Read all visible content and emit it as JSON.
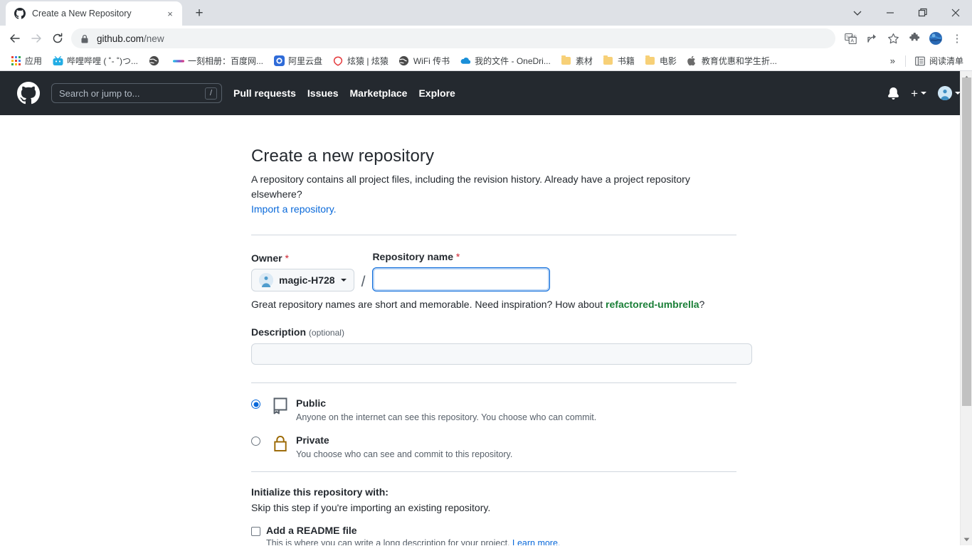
{
  "browser": {
    "tab": {
      "title": "Create a New Repository",
      "favicon": "github-icon",
      "close": "×"
    },
    "new_tab_label": "+",
    "window_controls": {
      "minimize": "—",
      "maximize": "❐",
      "close": "×",
      "tab_search": "⌄"
    },
    "toolbar": {
      "back": "←",
      "forward": "→",
      "reload": "⟳",
      "lock": "lock-icon",
      "url_secure": "github.com",
      "url_path": "/new",
      "translate": "translate-icon",
      "share": "share-icon",
      "bookmark": "star-icon",
      "extensions": "puzzle-icon",
      "profile": "profile-avatar-icon",
      "menu": "⋮"
    },
    "bookmarks": [
      {
        "label": "应用",
        "icon": "apps-grid-icon"
      },
      {
        "label": "哔哩哔哩 ( ˚- ˚)つ...",
        "icon": "bilibili-icon"
      },
      {
        "label": "",
        "icon": "globe-icon"
      },
      {
        "label": "一刻相册：百度网...",
        "icon": "gradient-bar-icon"
      },
      {
        "label": "阿里云盘",
        "icon": "aliyun-icon"
      },
      {
        "label": "炫猿 | 炫猿",
        "icon": "xuanyuan-icon"
      },
      {
        "label": "WiFi 传书",
        "icon": "globe-icon"
      },
      {
        "label": "我的文件 - OneDri...",
        "icon": "onedrive-icon"
      },
      {
        "label": "素材",
        "icon": "folder-icon"
      },
      {
        "label": "书籍",
        "icon": "folder-icon"
      },
      {
        "label": "电影",
        "icon": "folder-icon"
      },
      {
        "label": "教育优惠和学生折...",
        "icon": "apple-icon"
      }
    ],
    "bookmarks_overflow": "»",
    "reading_list": {
      "label": "阅读清单",
      "icon": "reading-list-icon"
    }
  },
  "github_header": {
    "logo": "github-mark-icon",
    "search_placeholder": "Search or jump to...",
    "search_shortcut": "/",
    "nav": [
      {
        "label": "Pull requests"
      },
      {
        "label": "Issues"
      },
      {
        "label": "Marketplace"
      },
      {
        "label": "Explore"
      }
    ],
    "notifications_icon": "bell-icon",
    "create_new_icon": "plus-icon",
    "avatar_icon": "user-avatar-icon"
  },
  "page": {
    "title": "Create a new repository",
    "subtitle": "A repository contains all project files, including the revision history. Already have a project repository elsewhere?",
    "import_link": "Import a repository.",
    "owner": {
      "label": "Owner",
      "required_mark": "*",
      "value": "magic-H728",
      "avatar": "user-avatar-icon",
      "caret": "chevron-down-icon"
    },
    "separator_slash": "/",
    "repo_name": {
      "label": "Repository name",
      "required_mark": "*",
      "value": "",
      "placeholder": ""
    },
    "name_hint_prefix": "Great repository names are short and memorable. Need inspiration? How about ",
    "name_suggestion": "refactored-umbrella",
    "name_hint_suffix": "?",
    "description": {
      "label": "Description",
      "optional_label": "(optional)",
      "value": "",
      "placeholder": ""
    },
    "visibility": [
      {
        "id": "public",
        "title": "Public",
        "desc": "Anyone on the internet can see this repository. You choose who can commit.",
        "icon": "repo-book-icon",
        "selected": true
      },
      {
        "id": "private",
        "title": "Private",
        "desc": "You choose who can see and commit to this repository.",
        "icon": "lock-icon",
        "selected": false
      }
    ],
    "initialize": {
      "title": "Initialize this repository with:",
      "subtitle": "Skip this step if you're importing an existing repository.",
      "readme": {
        "label": "Add a README file",
        "checked": false,
        "desc_prefix": "This is where you can write a long description for your project. ",
        "desc_link": "Learn more."
      }
    }
  },
  "colors": {
    "gh_header_bg": "#24292f",
    "accent_blue": "#0969da",
    "link_green": "#1a7f37",
    "required_red": "#cf222e",
    "lock_gold": "#9a6700",
    "chrome_tabstrip": "#dee1e6"
  }
}
